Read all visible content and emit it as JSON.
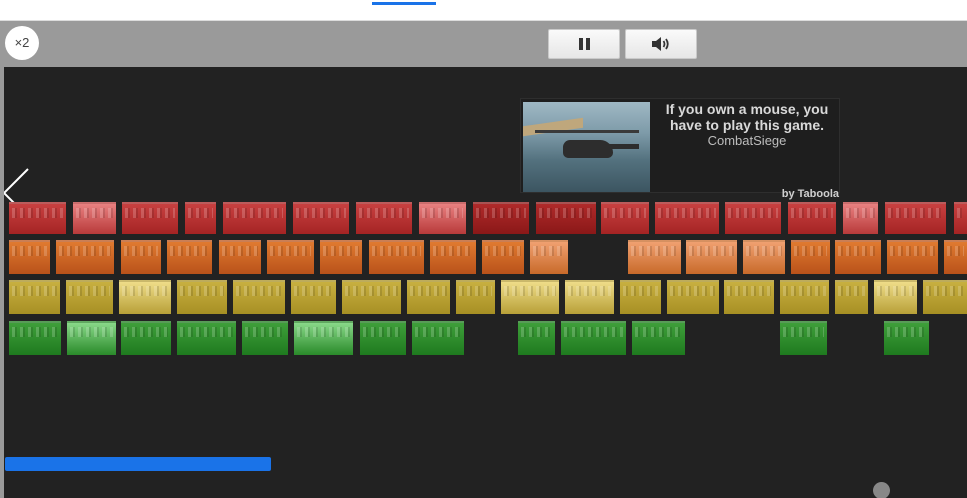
{
  "top_strip": {
    "active_tab": ""
  },
  "controls": {
    "multiplier_label": "×2",
    "pause_icon": "pause-icon",
    "sound_icon": "speaker-icon"
  },
  "ad": {
    "title": "If you own a mouse, you have to play this game.",
    "source": "CombatSiege",
    "attribution": "by Taboola",
    "image_icon": "helicopter-image"
  },
  "game": {
    "back_icon": "chevron-left-icon",
    "paddle_color": "#1a73e8",
    "background_color": "#222222",
    "brick_colors": {
      "red": "#b83030",
      "orange": "#d0652a",
      "yellow": "#bba238",
      "green": "#2a8a2a"
    },
    "brick_rows": [
      {
        "color": "red",
        "count": 18
      },
      {
        "color": "orange",
        "count": 19
      },
      {
        "color": "yellow",
        "count": 17
      },
      {
        "color": "green",
        "count": 12
      }
    ]
  }
}
